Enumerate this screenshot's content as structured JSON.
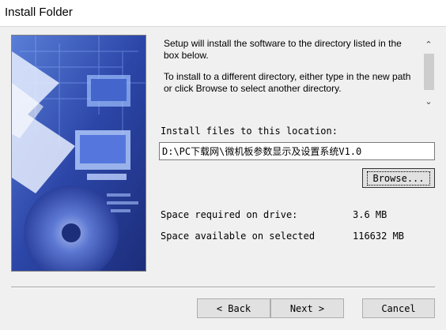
{
  "window": {
    "title": "Install Folder"
  },
  "description": {
    "paragraph1": "Setup will install the software to the directory listed in the box below.",
    "paragraph2": "To install to a different directory, either type in the new path or click Browse to select another directory."
  },
  "scrollbar": {
    "up_glyph": "^",
    "down_glyph": "v"
  },
  "location": {
    "label": "Install files to this location:",
    "path": "D:\\PC下载网\\微机板参数显示及设置系统V1.0"
  },
  "buttons": {
    "browse": "Browse...",
    "back": "< Back",
    "next": "Next >",
    "cancel": "Cancel"
  },
  "space": {
    "required_label": "Space required on drive:",
    "required_value": "3.6 MB",
    "available_label": "Space available on selected",
    "available_value": "116632 MB"
  },
  "colors": {
    "image_base": "#2a3f9a",
    "image_accent": "#7fb3ff"
  }
}
